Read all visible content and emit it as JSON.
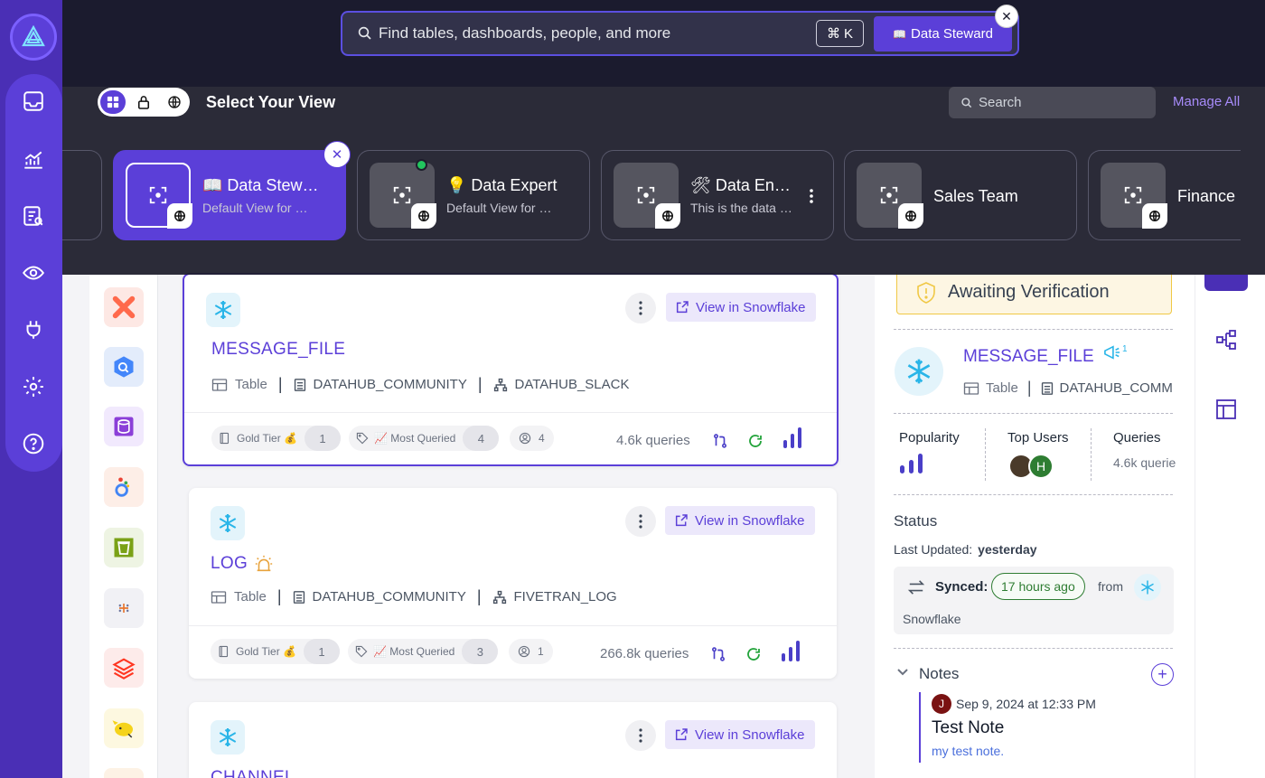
{
  "sidebar": {
    "items": [
      "inbox-icon",
      "analytics-icon",
      "glossary-icon",
      "eye-icon",
      "plug-icon",
      "gear-icon",
      "help-icon"
    ]
  },
  "search": {
    "placeholder": "Find tables, dashboards, people, and more",
    "shortcut_symbol": "⌘",
    "shortcut_key": "K",
    "view_button": "Data Steward",
    "view_emoji": "📖"
  },
  "view_selector": {
    "title": "Select Your View",
    "search_placeholder": "Search",
    "manage_all": "Manage All",
    "views": [
      {
        "name": "📖 Data Stew…",
        "desc": "Default View for …",
        "active": true
      },
      {
        "name": "💡 Data Expert",
        "desc": "Default View for …",
        "active": false
      },
      {
        "name": "🛠 Data Engin…",
        "desc": "This is the data …",
        "active": false
      },
      {
        "name": "Sales Team",
        "desc": "",
        "active": false
      },
      {
        "name": "Finance U",
        "desc": "",
        "active": false
      }
    ]
  },
  "results": [
    {
      "title": "MESSAGE_FILE",
      "type": "Table",
      "database": "DATAHUB_COMMUNITY",
      "schema": "DATAHUB_SLACK",
      "view_in": "View in Snowflake",
      "tier": "Gold Tier 💰",
      "tier_count": "1",
      "tag": "📈 Most Queried",
      "tag_count": "4",
      "owners": "4",
      "queries": "4.6k queries"
    },
    {
      "title": "LOG",
      "type": "Table",
      "database": "DATAHUB_COMMUNITY",
      "schema": "FIVETRAN_LOG",
      "view_in": "View in Snowflake",
      "tier": "Gold Tier 💰",
      "tier_count": "1",
      "tag": "📈 Most Queried",
      "tag_count": "3",
      "owners": "1",
      "queries": "266.8k queries"
    },
    {
      "title": "CHANNEL",
      "view_in": "View in Snowflake"
    }
  ],
  "detail": {
    "verification": "Awaiting Verification",
    "title": "MESSAGE_FILE",
    "announcement_count": "1",
    "type": "Table",
    "database": "DATAHUB_COMM",
    "popularity_label": "Popularity",
    "top_users_label": "Top Users",
    "top_user_initial": "H",
    "queries_label": "Queries",
    "queries_value": "4.6k querie",
    "status_heading": "Status",
    "last_updated_label": "Last Updated:",
    "last_updated_value": "yesterday",
    "synced_label": "Synced:",
    "synced_value": "17 hours ago",
    "from_label": "from",
    "source_name": "Snowflake",
    "notes_heading": "Notes",
    "note_author_initial": "J",
    "note_date": "Sep 9, 2024 at 12:33 PM",
    "note_title": "Test Note",
    "note_body": "my test note."
  },
  "colors": {
    "brand": "#5b3fd8",
    "sidebar": "#4a2fb5",
    "dark": "#1b1b2e",
    "synced_green": "#2e7d32"
  }
}
